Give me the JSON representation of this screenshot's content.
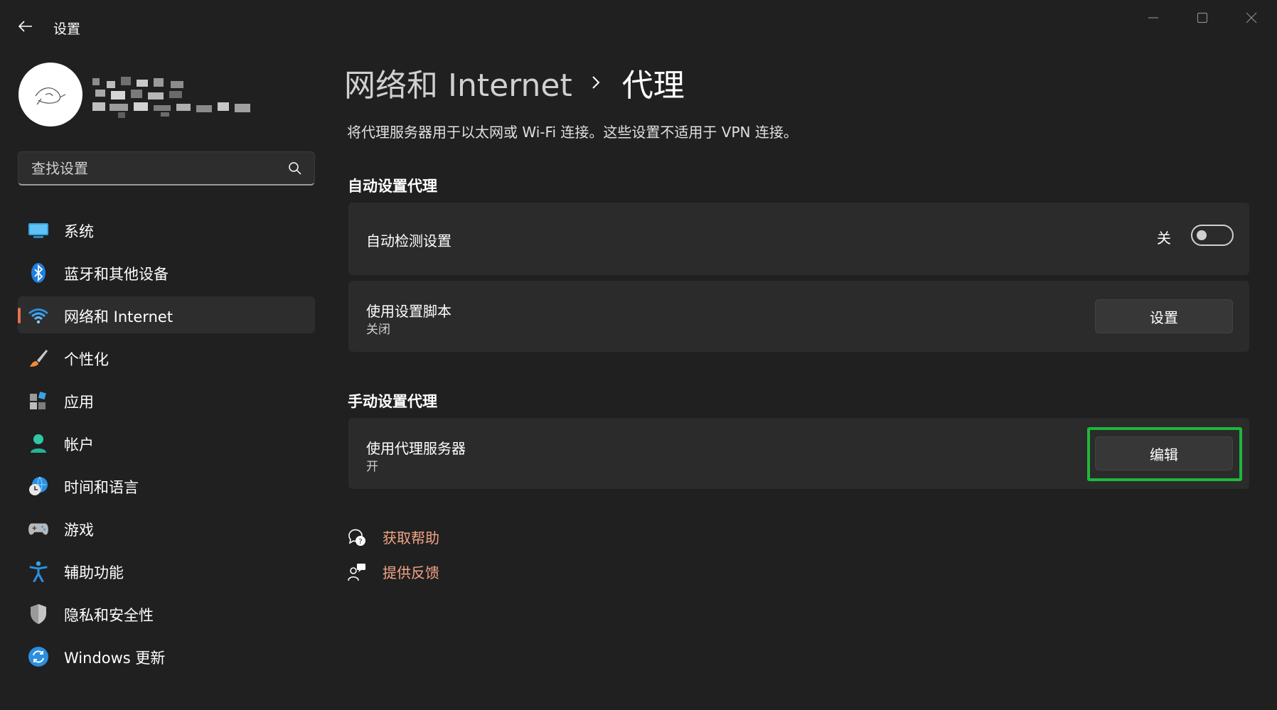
{
  "window": {
    "app_title": "设置",
    "controls": [
      "minimize-icon",
      "maximize-icon",
      "close-icon"
    ]
  },
  "sidebar": {
    "search_placeholder": "查找设置",
    "items": [
      {
        "label": "系统",
        "icon": "system-monitor-icon",
        "selected": false
      },
      {
        "label": "蓝牙和其他设备",
        "icon": "bluetooth-icon",
        "selected": false
      },
      {
        "label": "网络和 Internet",
        "icon": "wifi-icon",
        "selected": true
      },
      {
        "label": "个性化",
        "icon": "paintbrush-icon",
        "selected": false
      },
      {
        "label": "应用",
        "icon": "apps-icon",
        "selected": false
      },
      {
        "label": "帐户",
        "icon": "person-icon",
        "selected": false
      },
      {
        "label": "时间和语言",
        "icon": "globe-clock-icon",
        "selected": false
      },
      {
        "label": "游戏",
        "icon": "gamepad-icon",
        "selected": false
      },
      {
        "label": "辅助功能",
        "icon": "accessibility-icon",
        "selected": false
      },
      {
        "label": "隐私和安全性",
        "icon": "shield-icon",
        "selected": false
      },
      {
        "label": "Windows 更新",
        "icon": "update-icon",
        "selected": false
      }
    ]
  },
  "main": {
    "breadcrumb_parent": "网络和 Internet",
    "breadcrumb_current": "代理",
    "description": "将代理服务器用于以太网或 Wi-Fi 连接。这些设置不适用于 VPN 连接。",
    "auto_section": {
      "title": "自动设置代理",
      "auto_detect": {
        "label": "自动检测设置",
        "state_label": "关"
      },
      "setup_script": {
        "label": "使用设置脚本",
        "sublabel": "关闭",
        "button": "设置"
      }
    },
    "manual_section": {
      "title": "手动设置代理",
      "use_proxy": {
        "label": "使用代理服务器",
        "sublabel": "开",
        "button": "编辑"
      }
    },
    "links": {
      "help": "获取帮助",
      "feedback": "提供反馈"
    }
  },
  "colors": {
    "background": "#202020",
    "card": "#2b2b2b",
    "accent_indicator": "#e6714a",
    "link": "#f1a585",
    "highlight_box": "#1db83a"
  }
}
